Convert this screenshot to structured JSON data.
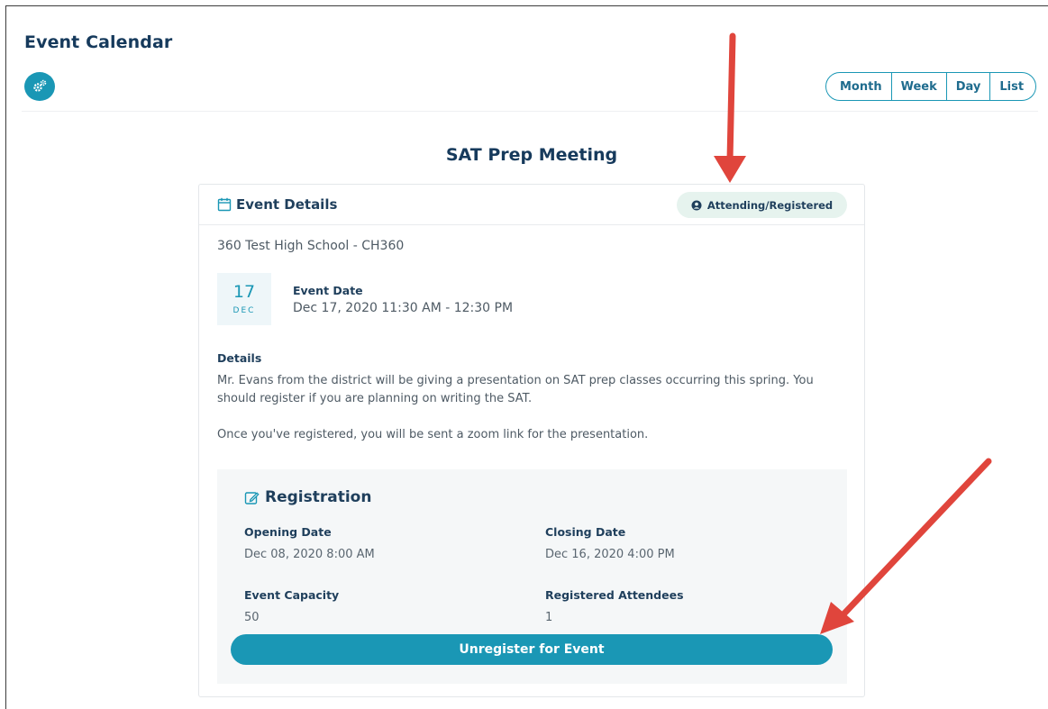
{
  "app": {
    "title": "Event Calendar"
  },
  "toolbar": {
    "settings_icon": "gears-icon",
    "views": [
      "Month",
      "Week",
      "Day",
      "List"
    ]
  },
  "event": {
    "title": "SAT Prep Meeting",
    "card_header": "Event Details",
    "card_header_icon": "calendar-icon",
    "status": {
      "label": "Attending/Registered",
      "icon": "user-circle-icon"
    },
    "location": "360 Test High School - CH360",
    "date_badge": {
      "day": "17",
      "month": "DEC"
    },
    "date_label": "Event Date",
    "date_value": "Dec 17, 2020 11:30 AM - 12:30 PM",
    "details_label": "Details",
    "details_paragraph1": "Mr. Evans from the district will be giving a presentation on SAT prep classes occurring this spring. You should register if you are planning on writing the SAT.",
    "details_paragraph2": "Once you've registered, you will be sent a zoom link for the presentation."
  },
  "registration": {
    "title": "Registration",
    "title_icon": "edit-icon",
    "opening_label": "Opening Date",
    "opening_value": "Dec 08, 2020 8:00 AM",
    "closing_label": "Closing Date",
    "closing_value": "Dec 16, 2020 4:00 PM",
    "capacity_label": "Event Capacity",
    "capacity_value": "50",
    "attendees_label": "Registered Attendees",
    "attendees_value": "1",
    "action_label": "Unregister for Event"
  },
  "colors": {
    "accent": "#1a97b5",
    "heading": "#163a5c",
    "status_bg": "#e6f3ee",
    "annotation_arrow": "#e0453c"
  }
}
